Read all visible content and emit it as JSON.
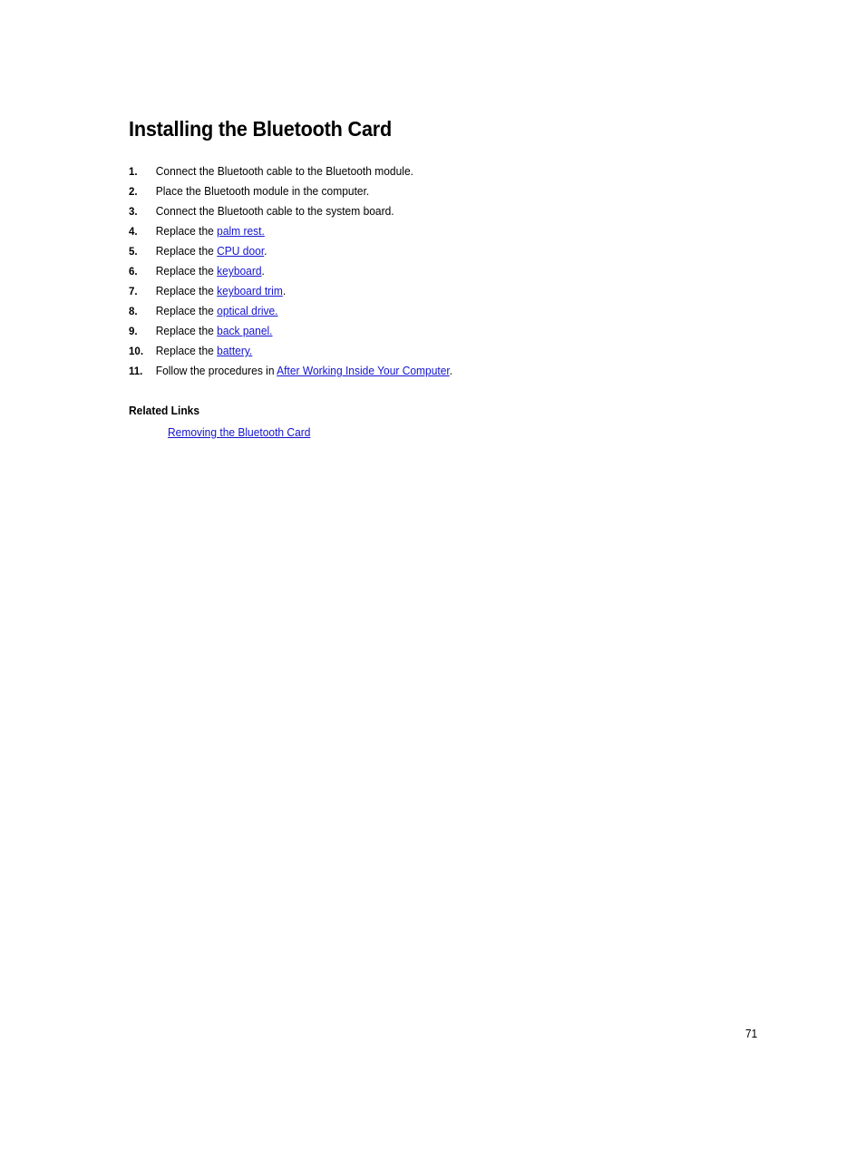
{
  "document": {
    "title": "Installing the Bluetooth Card",
    "page_number": "71",
    "link_color": "#1414cf",
    "text_color": "#000000",
    "background_color": "#ffffff"
  },
  "steps": [
    {
      "number": "1.",
      "before": "Connect the Bluetooth cable to the Bluetooth module.",
      "link": "",
      "after": ""
    },
    {
      "number": "2.",
      "before": "Place the Bluetooth module in the computer.",
      "link": "",
      "after": ""
    },
    {
      "number": "3.",
      "before": "Connect the Bluetooth cable to the system board.",
      "link": "",
      "after": ""
    },
    {
      "number": "4.",
      "before": "Replace the ",
      "link": "palm rest.",
      "after": ""
    },
    {
      "number": "5.",
      "before": "Replace the ",
      "link": "CPU door",
      "after": "."
    },
    {
      "number": "6.",
      "before": "Replace the ",
      "link": "keyboard",
      "after": "."
    },
    {
      "number": "7.",
      "before": "Replace the ",
      "link": "keyboard trim",
      "after": "."
    },
    {
      "number": "8.",
      "before": "Replace the ",
      "link": "optical drive.",
      "after": ""
    },
    {
      "number": "9.",
      "before": "Replace the ",
      "link": "back panel.",
      "after": ""
    },
    {
      "number": "10.",
      "before": "Replace the ",
      "link": "battery.",
      "after": ""
    },
    {
      "number": "11.",
      "before": "Follow the procedures in ",
      "link": "After Working Inside Your Computer",
      "after": "."
    }
  ],
  "related_links": {
    "heading": "Related Links",
    "items": [
      {
        "label": "Removing the Bluetooth Card"
      }
    ]
  }
}
